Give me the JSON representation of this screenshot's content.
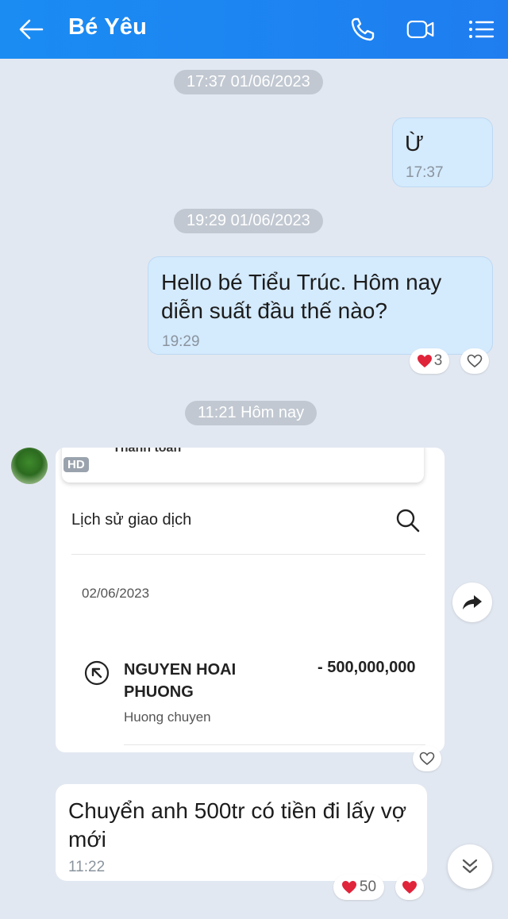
{
  "header": {
    "title": "Bé Yêu",
    "back_icon": "arrow-left-icon",
    "call_icon": "phone-icon",
    "video_icon": "video-camera-icon",
    "menu_icon": "list-menu-icon",
    "bg_color": "#1a8cf2"
  },
  "timestamps": {
    "first": "17:37 01/06/2023",
    "second": "19:29 01/06/2023",
    "third": "11:21 Hôm nay"
  },
  "messages": {
    "m1": {
      "text": "Ừ",
      "time": "17:37"
    },
    "m2": {
      "text": "Hello bé Tiểu Trúc. Hôm nay diễn suất đầu thế nào?",
      "time": "19:29",
      "reaction_count": "3"
    },
    "m4": {
      "text": "Chuyển anh 500tr có tiền đi lấy vợ mới",
      "time": "11:22",
      "reaction_count": "50"
    }
  },
  "image_card": {
    "badge": "HD",
    "payment_label": "Thanh toán",
    "history_title": "Lịch sử giao dịch",
    "date": "02/06/2023",
    "recipient": "NGUYEN HOAI PHUONG",
    "amount": "- 500,000,000",
    "description": "Huong chuyen"
  },
  "colors": {
    "outgoing_bubble": "#d4eafd",
    "incoming_bubble": "#ffffff",
    "heart": "#e0243a",
    "time_pill": "#c1c8d1"
  }
}
